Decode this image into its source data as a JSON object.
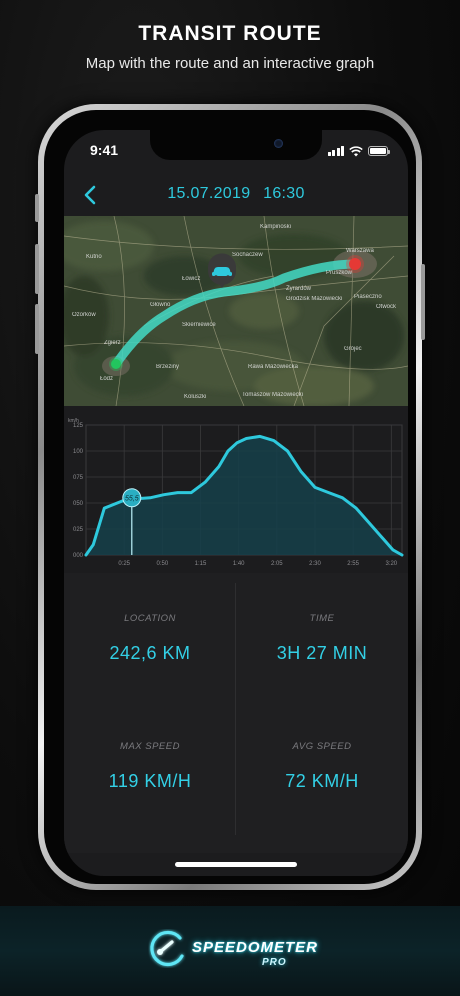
{
  "promo": {
    "title": "TRANSIT ROUTE",
    "subtitle": "Map with the route and an interactive graph"
  },
  "status_bar": {
    "time": "9:41"
  },
  "nav": {
    "back_icon": "chevron-left-icon",
    "date": "15.07.2019",
    "time": "16:30"
  },
  "map": {
    "labels": [
      "Warszawa",
      "Łódź",
      "Skierniewice",
      "Żyrardów",
      "Grodzisk Mazowiecki",
      "Łowicz",
      "Kutno",
      "Rawa Mazowiecka",
      "Piaseczno",
      "Otwock",
      "Pruszków",
      "Zgierz",
      "Tomaszów Mazowiecki",
      "Ozorków",
      "Kampinoski",
      "Grójec",
      "Brzeziny",
      "Koluszki",
      "Głowno",
      "Sochaczew"
    ],
    "route_color": "#43d9c4",
    "start_color": "#22c55e",
    "end_color": "#e53935",
    "car_icon": "car-icon"
  },
  "chart_data": {
    "type": "area",
    "ylabel": "km/h",
    "ytick_labels": [
      "000",
      "025",
      "050",
      "075",
      "100",
      "125"
    ],
    "xtick_labels": [
      "0:25",
      "0:50",
      "1:15",
      "1:40",
      "2:05",
      "2:30",
      "2:55",
      "3:20"
    ],
    "ylim": [
      0,
      125
    ],
    "x": [
      0,
      0.08,
      0.2,
      0.4,
      0.55,
      0.7,
      0.85,
      1.0,
      1.15,
      1.3,
      1.45,
      1.55,
      1.65,
      1.75,
      1.9,
      2.05,
      2.2,
      2.35,
      2.5,
      2.65,
      2.8,
      2.95,
      3.1,
      3.25,
      3.35,
      3.45
    ],
    "series": [
      {
        "values": [
          0,
          10,
          45,
          52,
          54,
          55,
          58,
          60,
          60,
          70,
          85,
          100,
          108,
          112,
          114,
          110,
          100,
          80,
          65,
          60,
          55,
          45,
          30,
          15,
          5,
          0
        ]
      }
    ],
    "selected": {
      "x": 0.5,
      "value": "55,5"
    },
    "grid": true,
    "line_color": "#2ec9dd"
  },
  "stats": {
    "location_label": "LOCATION",
    "location_value": "242,6 KM",
    "time_label": "TIME",
    "time_value": "3H 27 MIN",
    "max_speed_label": "MAX SPEED",
    "max_speed_value": "119 KM/H",
    "avg_speed_label": "AVG SPEED",
    "avg_speed_value": "72 KM/H"
  },
  "brand": {
    "name": "SPEEDOMETER",
    "suffix": "PRO",
    "logo_icon": "speedometer-gauge-icon"
  }
}
